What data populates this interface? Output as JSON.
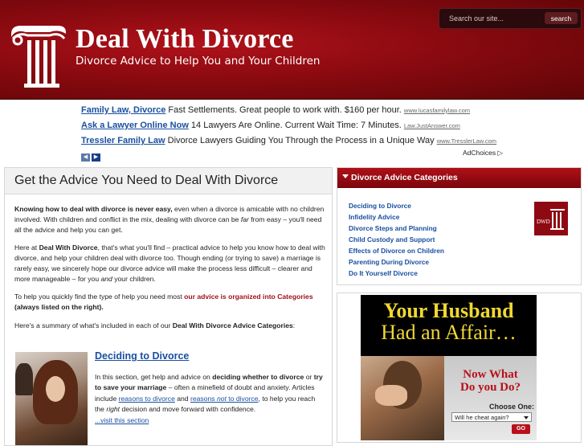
{
  "header": {
    "title": "Deal With Divorce",
    "tagline": "Divorce Advice to Help You and Your Children",
    "search_placeholder": "Search our site...",
    "search_button": "search"
  },
  "ads": [
    {
      "title": "Family Law, Divorce",
      "text": " Fast Settlements. Great people to work with. $160 per hour.",
      "url": "www.lucasfamilylaw.com"
    },
    {
      "title": "Ask a Lawyer Online Now",
      "text": " 14 Lawyers Are Online. Current Wait Time: 7 Minutes.",
      "url": "Law.JustAnswer.com"
    },
    {
      "title": "Tressler Family Law",
      "text": " Divorce Lawyers Guiding You Through the Process in a Unique Way",
      "url": "www.TresslerLaw.com"
    }
  ],
  "ad_prev": "◀",
  "ad_next": "▶",
  "adchoices": "AdChoices ▷",
  "main": {
    "title": "Get the Advice You Need to Deal With Divorce",
    "p1_bold": "Knowing how to deal with divorce is never easy,",
    "p1_a": " even when a divorce is amicable with no children involved. With children and conflict in the mix, dealing with divorce can be ",
    "p1_em": "far",
    "p1_b": " from easy – you'll need all the advice and help you can get.",
    "p2_a": "Here at ",
    "p2_bold": "Deal With Divorce",
    "p2_b": ", that's what you'll find – practical advice to help you know how to deal with divorce, and help your children deal with divorce too.  Though ending (or trying to save) a marriage is rarely easy, we sincerely hope our divorce advice will make the process less difficult – clearer and more manageable – for you ",
    "p2_em": "and",
    "p2_c": " your children.",
    "p3_a": "To help you quickly find the type of help you need most ",
    "p3_hl": "our advice is organized into Categories",
    "p3_bold": "(always listed on the right).",
    "p4_a": "Here's a summary of what's included in each of our ",
    "p4_bold": "Deal With Divorce Advice Categories",
    "p4_b": ":",
    "section": {
      "heading": "Deciding to Divorce",
      "t1": "In this section, get help and advice on ",
      "b1": "deciding whether to divorce",
      "t2": " or ",
      "b2": "try to save your marriage",
      "t3": " – often a minefield of doubt and anxiety. Articles include ",
      "link1": "reasons to divorce",
      "t4": " and ",
      "link2a": "reasons ",
      "link2em": "not",
      "link2b": " to divorce",
      "t5": ", to help you reach the ",
      "em": "right",
      "t6": " decision and move forward with confidence.",
      "more": "...visit this section"
    }
  },
  "sidebar": {
    "header": "Divorce Advice Categories",
    "items": [
      "Deciding to Divorce",
      "Infidelity Advice",
      "Divorce Steps and Planning",
      "Child Custody and Support",
      "Effects of Divorce on Children",
      "Parenting During Divorce",
      "Do It Yourself Divorce"
    ]
  },
  "banner": {
    "line1": "Your Husband",
    "line2": "Had an Affair…",
    "question1": "Now What",
    "question2": "Do you Do?",
    "choose": "Choose One:",
    "select_value": "Will he cheat again?",
    "go": "GO"
  },
  "colors": {
    "header_red": "#8a0a10",
    "link_blue": "#1a4fa0",
    "highlight_red": "#a0101a",
    "banner_yellow": "#f0d832"
  }
}
